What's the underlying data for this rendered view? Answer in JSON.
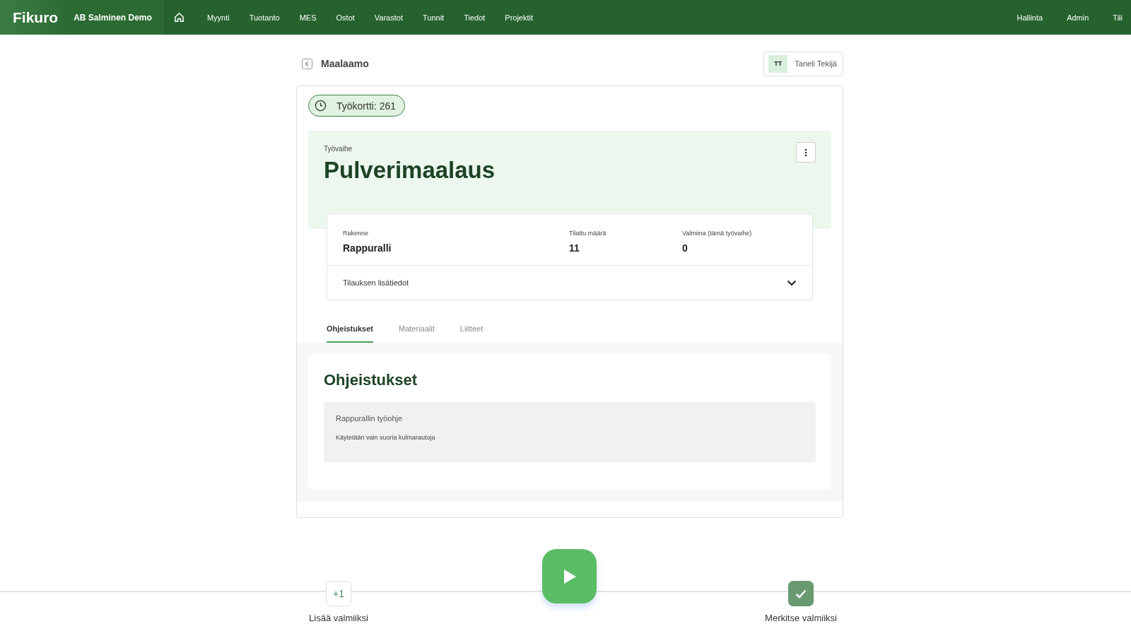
{
  "nav": {
    "logo": "Fikuro",
    "company": "AB Salminen Demo",
    "items": [
      "Myynti",
      "Tuotanto",
      "MES",
      "Ostot",
      "Varastot",
      "Tunnit",
      "Tiedot",
      "Projektit"
    ],
    "right_items": [
      "Hallinta",
      "Admin",
      "Tili"
    ]
  },
  "header": {
    "title": "Maalaamo",
    "user_initials": "TT",
    "user_name": "Taneli Tekijä"
  },
  "work_card": {
    "badge": "Työkortti: 261",
    "phase_label": "Työvaihe",
    "phase": "Pulverimaalaus",
    "fields": [
      {
        "label": "Rakenne",
        "value": "Rappuralli"
      },
      {
        "label": "Tilattu määrä",
        "value": "11"
      },
      {
        "label": "Valmiina (tämä työvaihe)",
        "value": "0"
      }
    ],
    "details": {
      "label": "Tilauksen lisätiedot",
      "expanded": false
    }
  },
  "tabs": [
    {
      "label": "Ohjeistukset",
      "selected": true
    },
    {
      "label": "Materiaalit",
      "selected": false
    },
    {
      "label": "Liitteet",
      "selected": false
    }
  ],
  "instructions": {
    "title": "Ohjeistukset",
    "note_title": "Rappurallin työohje",
    "note_text": "Käytetään vain suoria kulmarautoja"
  },
  "actions": {
    "add": {
      "icon_text": "+1",
      "label": "Lisää valmiiksi"
    },
    "complete": {
      "label": "Merkitse valmiiksi"
    }
  }
}
